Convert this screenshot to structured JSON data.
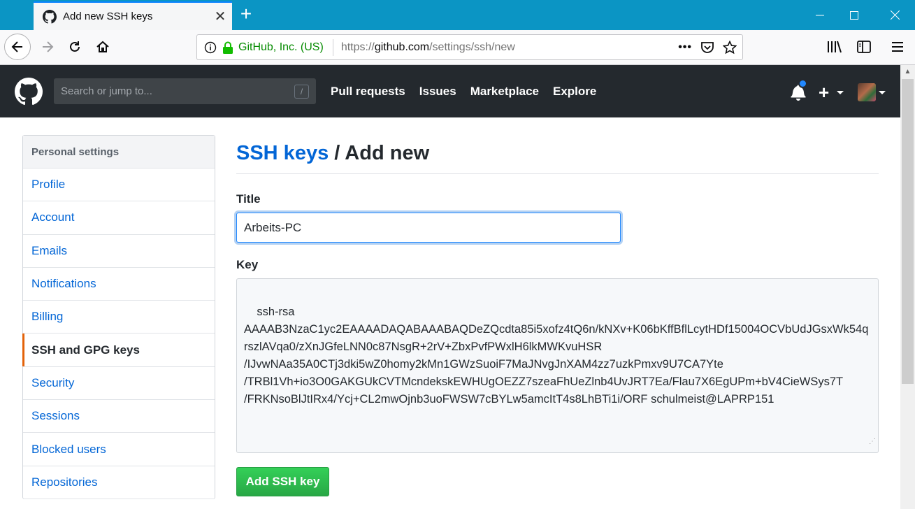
{
  "browser": {
    "tab_title": "Add new SSH keys",
    "url_identity": "GitHub, Inc. (US)",
    "url_prefix": "https://",
    "url_host": "github.com",
    "url_path": "/settings/ssh/new",
    "page_actions_label": "•••"
  },
  "github": {
    "search_placeholder": "Search or jump to...",
    "search_shortcut": "/",
    "nav": [
      "Pull requests",
      "Issues",
      "Marketplace",
      "Explore"
    ],
    "add_label": "+",
    "notification_color": "#2188ff"
  },
  "sidebar": {
    "heading": "Personal settings",
    "items": [
      {
        "label": "Profile",
        "active": false
      },
      {
        "label": "Account",
        "active": false
      },
      {
        "label": "Emails",
        "active": false
      },
      {
        "label": "Notifications",
        "active": false
      },
      {
        "label": "Billing",
        "active": false
      },
      {
        "label": "SSH and GPG keys",
        "active": true
      },
      {
        "label": "Security",
        "active": false
      },
      {
        "label": "Sessions",
        "active": false
      },
      {
        "label": "Blocked users",
        "active": false
      },
      {
        "label": "Repositories",
        "active": false
      }
    ]
  },
  "main": {
    "breadcrumb_link": "SSH keys",
    "breadcrumb_rest": " / Add new",
    "title_label": "Title",
    "title_value": "Arbeits-PC",
    "key_label": "Key",
    "key_value": "ssh-rsa\nAAAAB3NzaC1yc2EAAAADAQABAAABAQDeZQcdta85i5xofz4tQ6n/kNXv+K06bKffBflLcytHDf15004OCVbUdJGsxWk54qrszlAVqa0/zXnJGfeLNN0c87NsgR+2rV+ZbxPvfPWxlH6lkMWKvuHSR\n/IJvwNAa35A0CTj3dki5wZ0homy2kMn1GWzSuoiF7MaJNvgJnXAM4zz7uzkPmxv9U7CA7Yte\n/TRBl1Vh+io3O0GAKGUkCVTMcndekskEWHUgOEZZ7szeaFhUeZlnb4UvJRT7Ea/Flau7X6EgUPm+bV4CieWSys7T\n/FRKNsoBlJtIRx4/Ycj+CL2mwOjnb3uoFWSW7cBYLw5amcItT4s8LhBTi1i/ORF schulmeist@LAPRP151",
    "submit_label": "Add SSH key"
  },
  "colors": {
    "brand_blue": "#0366d6",
    "header_bg": "#24292e",
    "active_marker": "#e36209",
    "button_green": "#28a745"
  }
}
